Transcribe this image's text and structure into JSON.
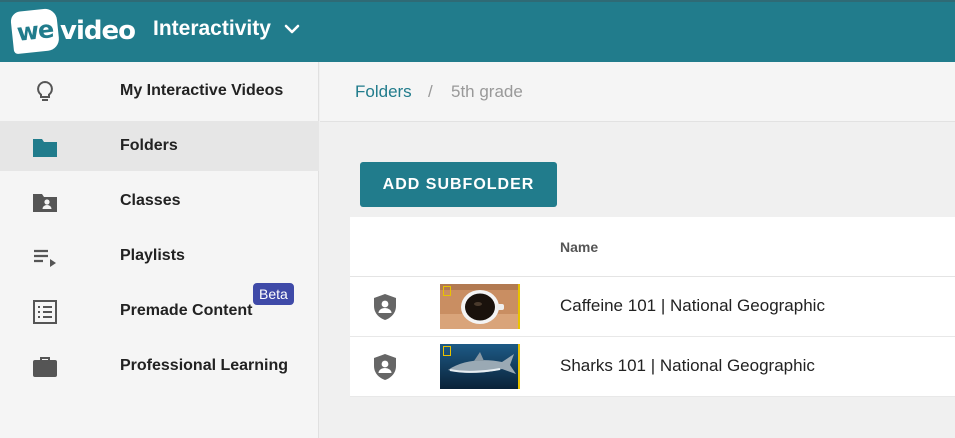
{
  "header": {
    "logo_we": "we",
    "logo_video": "video",
    "app_name": "Interactivity",
    "app_switch_icon": "chevron-down-icon"
  },
  "sidebar": {
    "items": [
      {
        "label": "My Interactive Videos",
        "icon": "lightbulb-icon",
        "active": false
      },
      {
        "label": "Folders",
        "icon": "folder-icon",
        "active": true
      },
      {
        "label": "Classes",
        "icon": "class-folder-icon",
        "active": false
      },
      {
        "label": "Playlists",
        "icon": "playlist-icon",
        "active": false
      },
      {
        "label": "Premade Content",
        "icon": "list-icon",
        "active": false,
        "badge": "Beta"
      },
      {
        "label": "Professional Learning",
        "icon": "briefcase-icon",
        "active": false
      }
    ]
  },
  "breadcrumb": {
    "root": "Folders",
    "separator": "/",
    "current": "5th grade"
  },
  "toolbar": {
    "add_subfolder_label": "ADD SUBFOLDER"
  },
  "table": {
    "columns": [
      "Name"
    ],
    "rows": [
      {
        "title": "Caffeine 101 | National Geographic",
        "icon": "shield-user-icon",
        "thumbnail": "coffee-cup"
      },
      {
        "title": "Sharks 101 | National Geographic",
        "icon": "shield-user-icon",
        "thumbnail": "shark"
      }
    ]
  },
  "colors": {
    "brand": "#217c8c",
    "badge": "#3f4aa8",
    "thumb_marker": "#e8c200"
  }
}
